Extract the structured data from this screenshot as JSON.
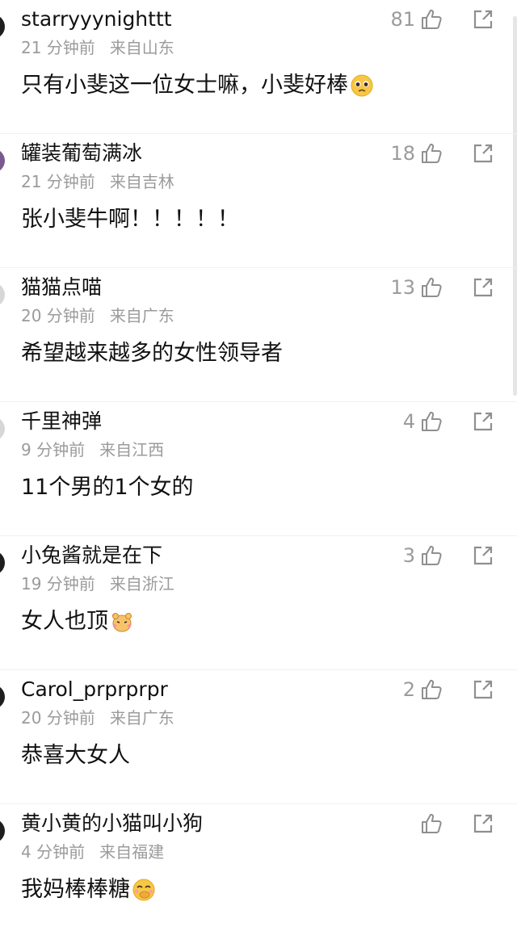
{
  "comments": [
    {
      "username": "starryyynighttt",
      "time": "21 分钟前",
      "location": "来自山东",
      "text": "只有小斐这一位女士嘛，小斐好棒",
      "emoji": "pleading-face",
      "likes": "81"
    },
    {
      "username": "罐装葡萄满冰",
      "time": "21 分钟前",
      "location": "来自吉林",
      "text": "张小斐牛啊！！！！！",
      "emoji": "",
      "likes": "18"
    },
    {
      "username": "猫猫点喵",
      "time": "20 分钟前",
      "location": "来自广东",
      "text": "希望越来越多的女性领导者",
      "emoji": "",
      "likes": "13"
    },
    {
      "username": "千里神弹",
      "time": "9 分钟前",
      "location": "来自江西",
      "text": "11个男的1个女的",
      "emoji": "",
      "likes": "4"
    },
    {
      "username": "小兔酱就是在下",
      "time": "19 分钟前",
      "location": "来自浙江",
      "text": "女人也顶",
      "emoji": "hamster",
      "likes": "3"
    },
    {
      "username": "Carol_prprprpr",
      "time": "20 分钟前",
      "location": "来自广东",
      "text": "恭喜大女人",
      "emoji": "",
      "likes": "2"
    },
    {
      "username": "黄小黄的小猫叫小狗",
      "time": "4 分钟前",
      "location": "来自福建",
      "text": "我妈棒棒糖",
      "emoji": "giggle-face",
      "likes": ""
    }
  ],
  "icons": {
    "like": "thumbs-up-icon",
    "share": "share-icon"
  },
  "colors": {
    "text": "#111111",
    "meta": "#9b9b9b",
    "icon": "#8f8f8f",
    "divider": "#f0f0f0"
  }
}
